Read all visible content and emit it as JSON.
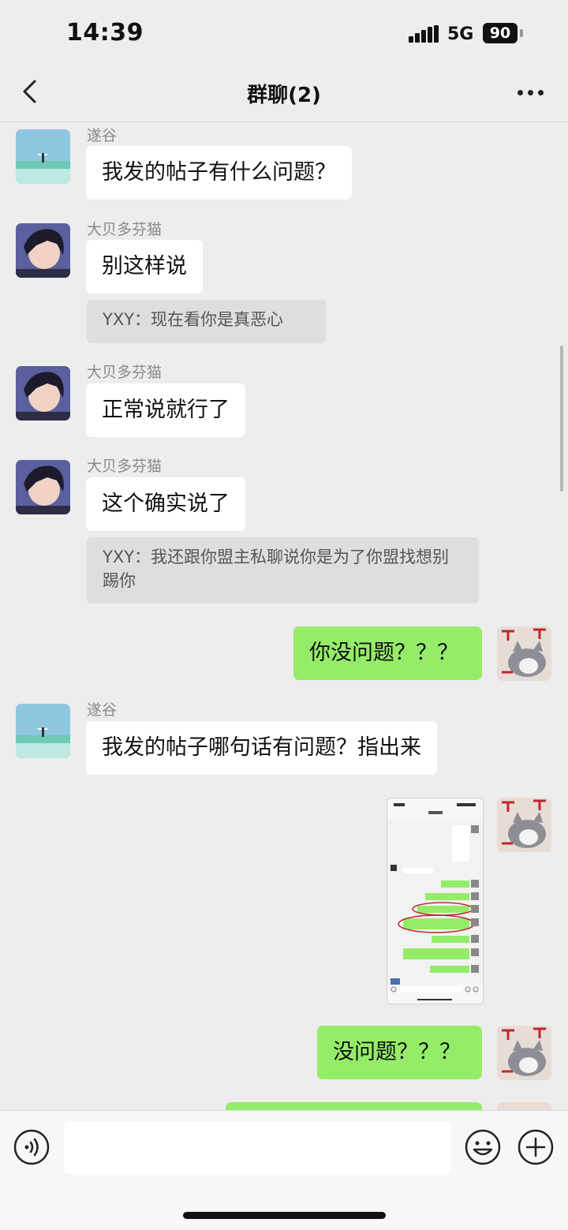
{
  "status_bar": {
    "time": "14:39",
    "network": "5G",
    "battery": "90"
  },
  "nav": {
    "title": "群聊(2)"
  },
  "messages": [
    {
      "sender": "遂谷",
      "text": "我发的帖子有什么问题？"
    },
    {
      "sender": "大贝多芬猫",
      "text": "别这样说",
      "quote": "YXY：现在看你是真恶心"
    },
    {
      "sender": "大贝多芬猫",
      "text": "正常说就行了"
    },
    {
      "sender": "大贝多芬猫",
      "text": "这个确实说了",
      "quote": "YXY：我还跟你盟主私聊说你是为了你盟找想别踢你"
    },
    {
      "text": "你没问题？？？"
    },
    {
      "sender": "遂谷",
      "text": "我发的帖子哪句话有问题？指出来"
    },
    {
      "image": "screenshot-thumbnail"
    },
    {
      "text": "没问题？？？"
    }
  ],
  "input": {
    "placeholder": ""
  },
  "icons": {
    "back": "chevron-left-icon",
    "more": "more-dots-icon",
    "voice": "voice-icon",
    "emoji": "emoji-icon",
    "plus": "plus-icon"
  },
  "colors": {
    "outgoing_bubble": "#95ec69",
    "incoming_bubble": "#ffffff",
    "background": "#ededed"
  }
}
